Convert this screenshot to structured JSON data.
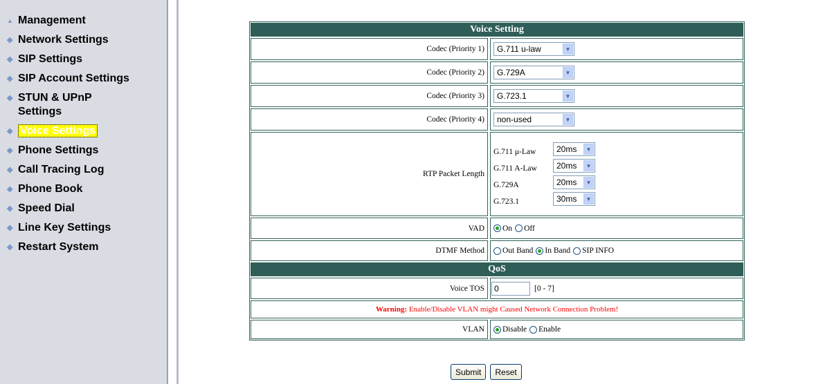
{
  "sidebar": {
    "items": [
      {
        "label": "Management",
        "icon": "triangle-icon"
      },
      {
        "label": "Network Settings",
        "icon": "diamond-icon"
      },
      {
        "label": "SIP Settings",
        "icon": "diamond-icon"
      },
      {
        "label": "SIP Account Settings",
        "icon": "diamond-icon"
      },
      {
        "label": "STUN & UPnP Settings",
        "icon": "diamond-icon"
      },
      {
        "label": "Voice Settings",
        "icon": "diamond-icon",
        "active": true
      },
      {
        "label": "Phone Settings",
        "icon": "diamond-icon"
      },
      {
        "label": "Call Tracing Log",
        "icon": "diamond-icon"
      },
      {
        "label": "Phone Book",
        "icon": "diamond-icon"
      },
      {
        "label": "Speed Dial",
        "icon": "diamond-icon"
      },
      {
        "label": "Line Key Settings",
        "icon": "diamond-icon"
      },
      {
        "label": "Restart System",
        "icon": "diamond-icon"
      }
    ]
  },
  "voice": {
    "title": "Voice Setting",
    "codec1": {
      "label": "Codec (Priority 1)",
      "value": "G.711 u-law"
    },
    "codec2": {
      "label": "Codec (Priority 2)",
      "value": "G.729A"
    },
    "codec3": {
      "label": "Codec (Priority 3)",
      "value": "G.723.1"
    },
    "codec4": {
      "label": "Codec (Priority 4)",
      "value": "non-used"
    },
    "rtp": {
      "label": "RTP Packet Length",
      "rows": [
        {
          "codec": "G.711 μ-Law",
          "value": "20ms"
        },
        {
          "codec": "G.711 A-Law",
          "value": "20ms"
        },
        {
          "codec": "G.729A",
          "value": "20ms"
        },
        {
          "codec": "G.723.1",
          "value": "30ms"
        }
      ]
    },
    "vad": {
      "label": "VAD",
      "on": "On",
      "off": "Off"
    },
    "dtmf": {
      "label": "DTMF Method",
      "out_band": "Out Band",
      "in_band": "In Band",
      "sip_info": "SIP INFO"
    }
  },
  "qos": {
    "title": "QoS",
    "tos": {
      "label": "Voice TOS",
      "value": "0",
      "range": "[0 - 7]"
    },
    "warning": {
      "prefix": "Warning:",
      "text": " Enable/Disable VLAN might Caused Network Connection Problem!"
    },
    "vlan": {
      "label": "VLAN",
      "disable": "Disable",
      "enable": "Enable"
    }
  },
  "buttons": {
    "submit": "Submit",
    "reset": "Reset"
  },
  "colors": {
    "header_bg": "#2f5e59",
    "sidebar_bg": "#d9dce3",
    "active_highlight": "#ffff00",
    "warning": "#ff0000"
  }
}
